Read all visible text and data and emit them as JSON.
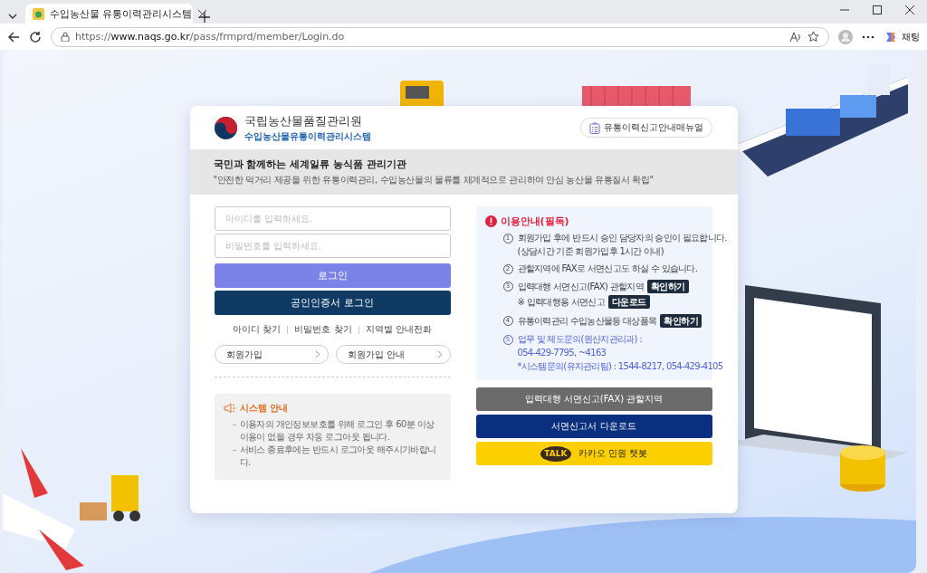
{
  "browser": {
    "tabs": [
      {
        "title": "수입농산물 유통이력관리시스템",
        "selected": true
      }
    ],
    "url_scheme": "https://",
    "url_host": "www.naqs.go.kr",
    "url_path": "/pass/frmprd/member/Login.do",
    "chat_label": "채팅"
  },
  "card": {
    "org_name": "국립농산물품질관리원",
    "system_name": "수입농산물유통이력관리시스템",
    "manual_button": "유통이력신고안내매뉴얼",
    "slogan_title": "국민과 함께하는 세계일류 농식품 관리기관",
    "slogan_text": "\"안전한 먹거리 제공을 위한 유통이력관리, 수입농산물의 물류를 체계적으로 관리하여 안심 농산물 유통질서 확립\"",
    "id_placeholder": "아이디를 입력하세요.",
    "password_placeholder": "비밀번호를 입력하세요.",
    "login_button": "로그인",
    "cert_login_button": "공인인증서 로그인",
    "links": [
      "아이디 찾기",
      "비밀번호 찾기",
      "지역별 안내전화"
    ],
    "join_buttons": [
      "회원가입",
      "회원가입 안내"
    ],
    "system_notice": {
      "title": "시스템 안내",
      "items": [
        "이용자의 개인정보보호를 위해 로그인 후 60분 이상 이용이 없을 경우 자동 로그아웃 됩니다.",
        "서비스 종료후에는 반드시 로그아웃 해주시기바랍니다."
      ]
    },
    "notice": {
      "title": "이용안내(필독)",
      "items": [
        {
          "number": "1",
          "kind": "info",
          "lines": [
            {
              "text": "회원가입 후에 반드시 승인 담당자의 승인이 필요합니다."
            },
            {
              "text": "(상담시간 기준 회원가입후 1시간 이내)"
            }
          ]
        },
        {
          "number": "2",
          "kind": "info",
          "lines": [
            {
              "text": "관할지역에 FAX로 서면신고도 하실 수 있습니다."
            }
          ]
        },
        {
          "number": "3",
          "kind": "info",
          "lines": [
            {
              "text": "입력대행 서면신고(FAX) 관할지역",
              "button": "확인하기"
            },
            {
              "text": "※ 입력대행용 서면신고",
              "button": "다운로드"
            }
          ]
        },
        {
          "number": "4",
          "kind": "info",
          "lines": [
            {
              "text": "유통이력관리 수입농산물등 대상품목",
              "button": "확인하기"
            }
          ]
        },
        {
          "number": "5",
          "kind": "contact",
          "lines": [
            {
              "text": "업무 및 제도문의(원산지관리과) :"
            },
            {
              "text": "054-429-7795, ~4163"
            },
            {
              "text": "*시스템문의(유지관리팀) : 1544-8217, 054-429-4105"
            }
          ]
        }
      ]
    },
    "action_buttons": [
      {
        "label": "입력대행 서면신고(FAX) 관할지역",
        "kind": "gray"
      },
      {
        "label": "서면신고서 다운로드",
        "kind": "navy"
      },
      {
        "label": "카카오 민원 챗봇",
        "kind": "kakao",
        "icon_text": "TALK"
      }
    ]
  }
}
